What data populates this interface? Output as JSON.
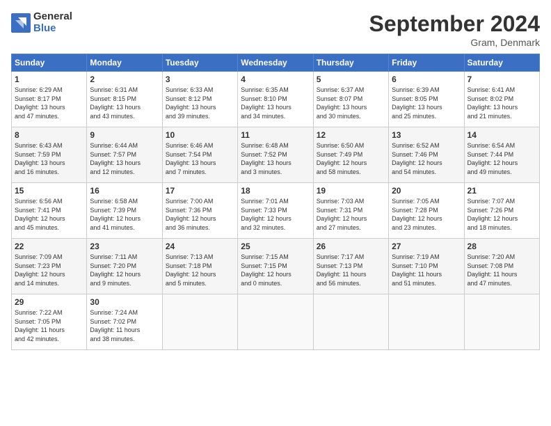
{
  "logo": {
    "general": "General",
    "blue": "Blue"
  },
  "title": "September 2024",
  "subtitle": "Gram, Denmark",
  "days_of_week": [
    "Sunday",
    "Monday",
    "Tuesday",
    "Wednesday",
    "Thursday",
    "Friday",
    "Saturday"
  ],
  "weeks": [
    [
      {
        "day": "1",
        "info": "Sunrise: 6:29 AM\nSunset: 8:17 PM\nDaylight: 13 hours\nand 47 minutes."
      },
      {
        "day": "2",
        "info": "Sunrise: 6:31 AM\nSunset: 8:15 PM\nDaylight: 13 hours\nand 43 minutes."
      },
      {
        "day": "3",
        "info": "Sunrise: 6:33 AM\nSunset: 8:12 PM\nDaylight: 13 hours\nand 39 minutes."
      },
      {
        "day": "4",
        "info": "Sunrise: 6:35 AM\nSunset: 8:10 PM\nDaylight: 13 hours\nand 34 minutes."
      },
      {
        "day": "5",
        "info": "Sunrise: 6:37 AM\nSunset: 8:07 PM\nDaylight: 13 hours\nand 30 minutes."
      },
      {
        "day": "6",
        "info": "Sunrise: 6:39 AM\nSunset: 8:05 PM\nDaylight: 13 hours\nand 25 minutes."
      },
      {
        "day": "7",
        "info": "Sunrise: 6:41 AM\nSunset: 8:02 PM\nDaylight: 13 hours\nand 21 minutes."
      }
    ],
    [
      {
        "day": "8",
        "info": "Sunrise: 6:43 AM\nSunset: 7:59 PM\nDaylight: 13 hours\nand 16 minutes."
      },
      {
        "day": "9",
        "info": "Sunrise: 6:44 AM\nSunset: 7:57 PM\nDaylight: 13 hours\nand 12 minutes."
      },
      {
        "day": "10",
        "info": "Sunrise: 6:46 AM\nSunset: 7:54 PM\nDaylight: 13 hours\nand 7 minutes."
      },
      {
        "day": "11",
        "info": "Sunrise: 6:48 AM\nSunset: 7:52 PM\nDaylight: 13 hours\nand 3 minutes."
      },
      {
        "day": "12",
        "info": "Sunrise: 6:50 AM\nSunset: 7:49 PM\nDaylight: 12 hours\nand 58 minutes."
      },
      {
        "day": "13",
        "info": "Sunrise: 6:52 AM\nSunset: 7:46 PM\nDaylight: 12 hours\nand 54 minutes."
      },
      {
        "day": "14",
        "info": "Sunrise: 6:54 AM\nSunset: 7:44 PM\nDaylight: 12 hours\nand 49 minutes."
      }
    ],
    [
      {
        "day": "15",
        "info": "Sunrise: 6:56 AM\nSunset: 7:41 PM\nDaylight: 12 hours\nand 45 minutes."
      },
      {
        "day": "16",
        "info": "Sunrise: 6:58 AM\nSunset: 7:39 PM\nDaylight: 12 hours\nand 41 minutes."
      },
      {
        "day": "17",
        "info": "Sunrise: 7:00 AM\nSunset: 7:36 PM\nDaylight: 12 hours\nand 36 minutes."
      },
      {
        "day": "18",
        "info": "Sunrise: 7:01 AM\nSunset: 7:33 PM\nDaylight: 12 hours\nand 32 minutes."
      },
      {
        "day": "19",
        "info": "Sunrise: 7:03 AM\nSunset: 7:31 PM\nDaylight: 12 hours\nand 27 minutes."
      },
      {
        "day": "20",
        "info": "Sunrise: 7:05 AM\nSunset: 7:28 PM\nDaylight: 12 hours\nand 23 minutes."
      },
      {
        "day": "21",
        "info": "Sunrise: 7:07 AM\nSunset: 7:26 PM\nDaylight: 12 hours\nand 18 minutes."
      }
    ],
    [
      {
        "day": "22",
        "info": "Sunrise: 7:09 AM\nSunset: 7:23 PM\nDaylight: 12 hours\nand 14 minutes."
      },
      {
        "day": "23",
        "info": "Sunrise: 7:11 AM\nSunset: 7:20 PM\nDaylight: 12 hours\nand 9 minutes."
      },
      {
        "day": "24",
        "info": "Sunrise: 7:13 AM\nSunset: 7:18 PM\nDaylight: 12 hours\nand 5 minutes."
      },
      {
        "day": "25",
        "info": "Sunrise: 7:15 AM\nSunset: 7:15 PM\nDaylight: 12 hours\nand 0 minutes."
      },
      {
        "day": "26",
        "info": "Sunrise: 7:17 AM\nSunset: 7:13 PM\nDaylight: 11 hours\nand 56 minutes."
      },
      {
        "day": "27",
        "info": "Sunrise: 7:19 AM\nSunset: 7:10 PM\nDaylight: 11 hours\nand 51 minutes."
      },
      {
        "day": "28",
        "info": "Sunrise: 7:20 AM\nSunset: 7:08 PM\nDaylight: 11 hours\nand 47 minutes."
      }
    ],
    [
      {
        "day": "29",
        "info": "Sunrise: 7:22 AM\nSunset: 7:05 PM\nDaylight: 11 hours\nand 42 minutes."
      },
      {
        "day": "30",
        "info": "Sunrise: 7:24 AM\nSunset: 7:02 PM\nDaylight: 11 hours\nand 38 minutes."
      },
      {
        "day": "",
        "info": ""
      },
      {
        "day": "",
        "info": ""
      },
      {
        "day": "",
        "info": ""
      },
      {
        "day": "",
        "info": ""
      },
      {
        "day": "",
        "info": ""
      }
    ]
  ]
}
